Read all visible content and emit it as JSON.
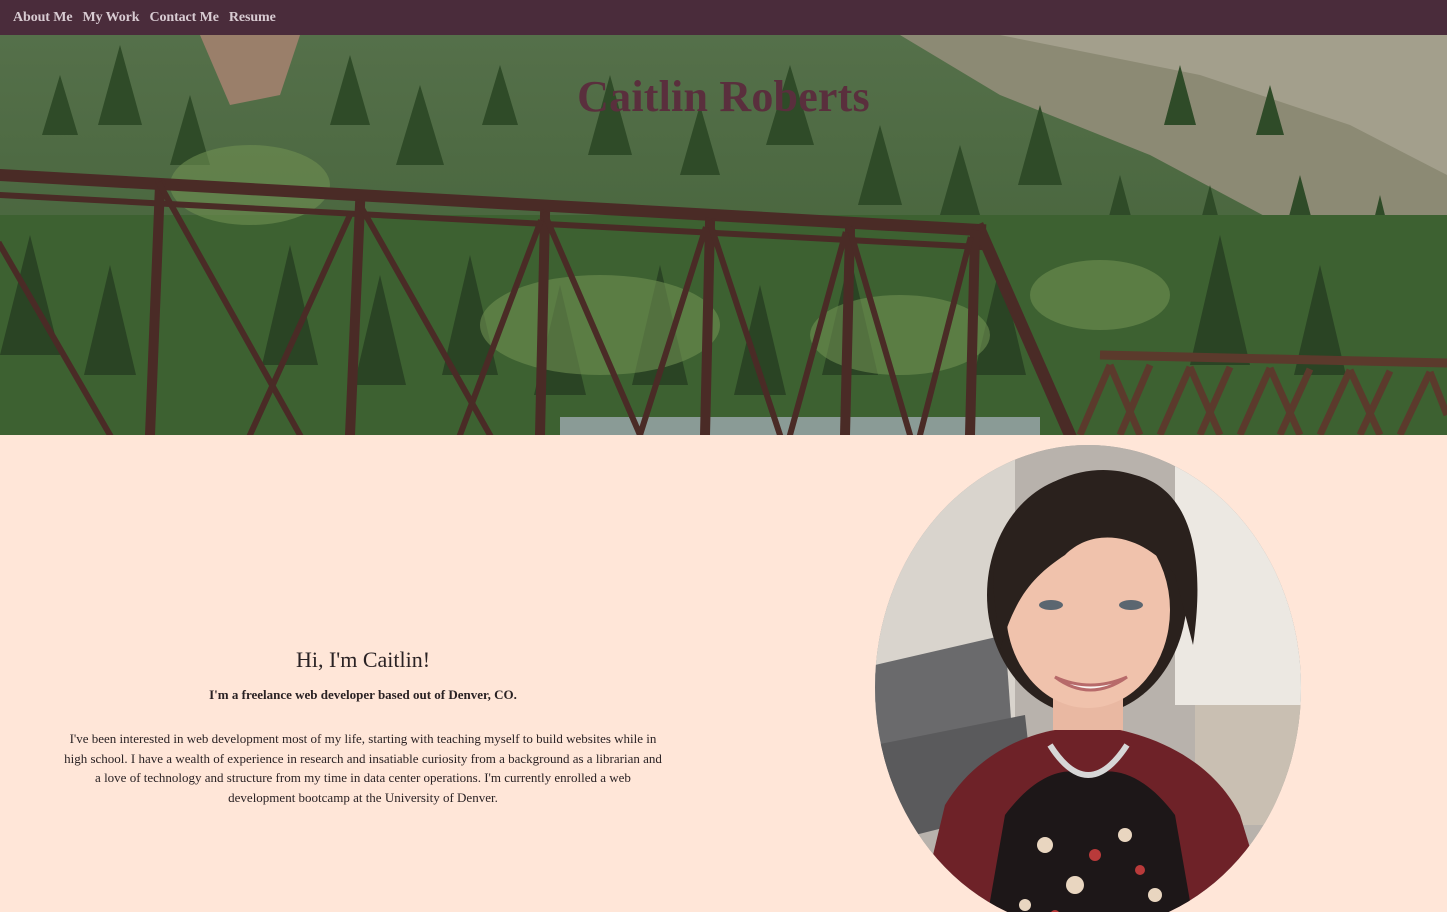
{
  "nav": {
    "items": [
      {
        "label": "About Me"
      },
      {
        "label": "My Work"
      },
      {
        "label": "Contact Me"
      },
      {
        "label": "Resume"
      }
    ]
  },
  "hero": {
    "title": "Caitlin Roberts"
  },
  "about": {
    "greeting": "Hi, I'm Caitlin!",
    "tagline": "I'm a freelance web developer based out of Denver, CO.",
    "bio": "I've been interested in web development most of my life, starting with teaching myself to build websites while in high school. I have a wealth of experience in research and insatiable curiosity from a background as a librarian and a love of technology and structure from my time in data center operations. I'm currently enrolled a web development bootcamp at the University of Denver."
  },
  "colors": {
    "nav_bg": "#4a2c3b",
    "page_bg": "#ffe6d8",
    "title": "#5a2f3d"
  }
}
